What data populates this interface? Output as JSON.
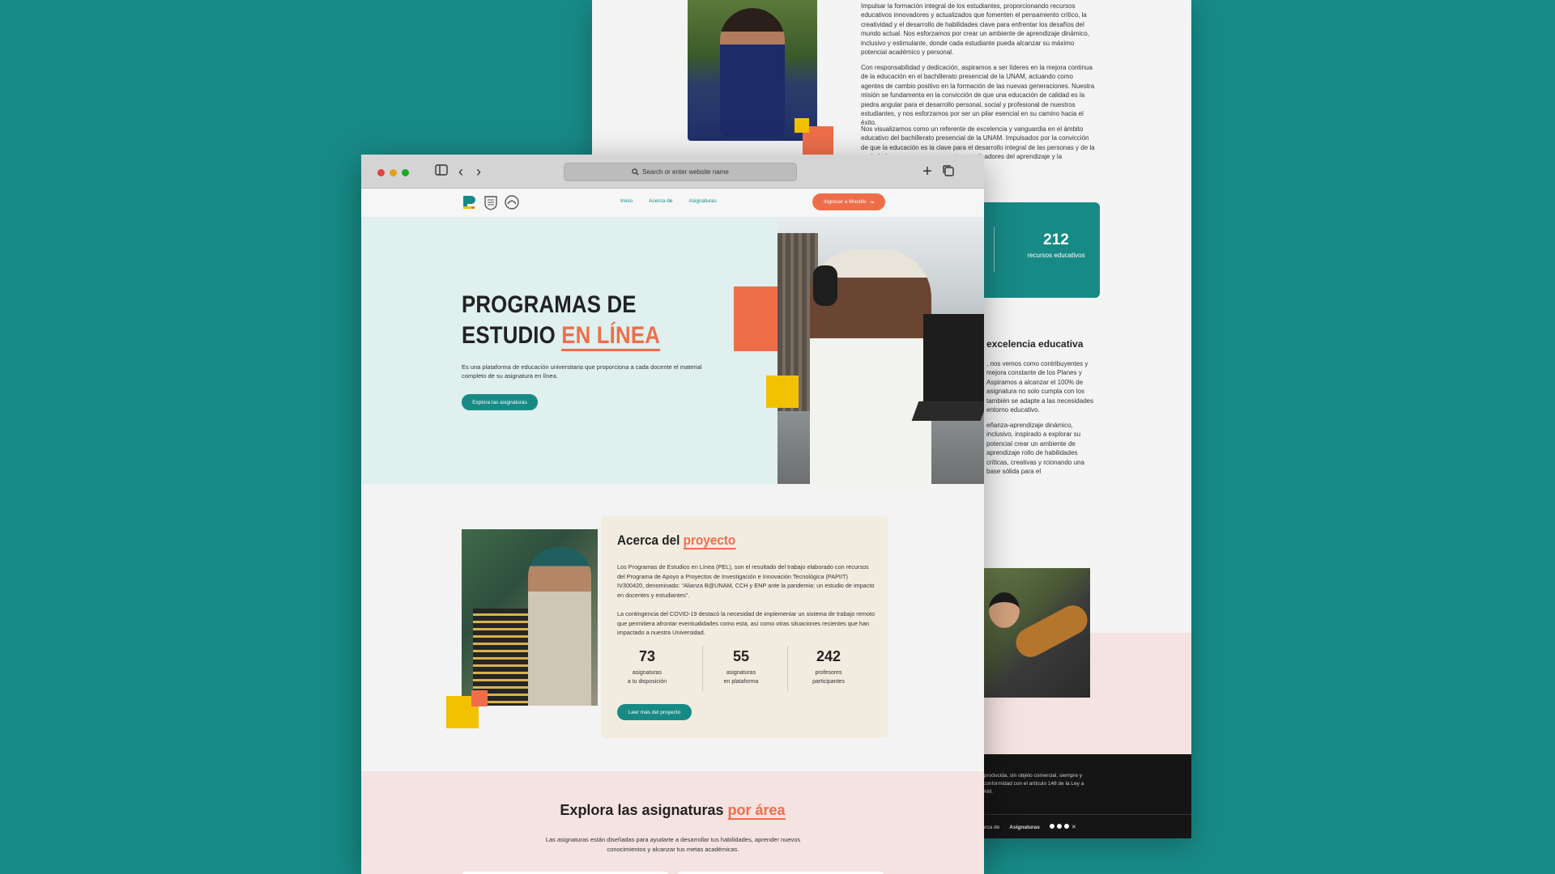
{
  "back_page": {
    "paragraphs": [
      "Impulsar la formación integral de los estudiantes, proporcionando recursos educativos innovadores y actualizados que fomenten el pensamiento crítico, la creatividad y el desarrollo de habilidades clave para enfrentar los desafíos del mundo actual. Nos esforzamos por crear un ambiente de aprendizaje dinámico, inclusivo y estimulante, donde cada estudiante pueda alcanzar su máximo potencial académico y personal.",
      "Con responsabilidad y dedicación, aspiramos a ser líderes en la mejora continua de la educación en el bachillerato presencial de la UNAM, actuando como agentes de cambio positivo en la formación de las nuevas generaciones. Nuestra misión se fundamenta en la convicción de que una educación de calidad es la piedra angular para el desarrollo personal, social y profesional de nuestros estudiantes, y nos esforzamos por ser un pilar esencial en su camino hacia el éxito.",
      "Nos visualizamos como un referente de excelencia y vanguardia en el ámbito educativo del bachillerato presencial de la UNAM. Impulsados por la convicción de que la educación es la clave para el desarrollo integral de las personas y de la sociedad, nos vemos como agentes catalizadores del aprendizaje y la"
    ],
    "stat": {
      "value": "212",
      "label": "recursos educativos",
      "faint": "s"
    },
    "heading": "excelencia educativa",
    "paragraphs2": [
      ", nos vemos como contribuyentes y mejora constante de los Planes y Aspiramos a alcanzar el 100% de asignatura no solo cumpla con los también se adapte a las necesidades entorno educativo.",
      "eñanza-aprendizaje dinámico, inclusivo, inspirado a explorar su potencial crear un ambiente de aprendizaje rollo de habilidades críticas, creativas y rcionando una base sólida para el"
    ],
    "footer": {
      "text": "r reproducida, sin objeto comercial, siempre y de conformidad con el artículo 148 de la Ley a UNAM.",
      "links": [
        "Acerca de",
        "Asignaturas"
      ]
    }
  },
  "browser": {
    "address_placeholder": "Search or enter website name",
    "controls": {
      "sidebar": "sidebar-toggle-icon",
      "back": "‹",
      "forward": "›",
      "new_tab": "+",
      "tabs": "tabs-icon"
    }
  },
  "nav": {
    "links": [
      "Inicio",
      "Acerca de",
      "Asignaturas"
    ],
    "cta": "Ingresar a Moodle"
  },
  "hero": {
    "title_line1": "PROGRAMAS DE",
    "title_line2_plain": "ESTUDIO ",
    "title_line2_accent": "EN LÍNEA",
    "description": "Es una plataforma de educación universitaria que proporciona a cada docente el material completo de su asignatura en línea.",
    "button": "Explora las asignaturas"
  },
  "about": {
    "title_plain": "Acerca del ",
    "title_accent": "proyecto",
    "p1": "Los Programas de Estudios en Línea (PEL), son el resultado del trabajo elaborado con recursos del Programa de Apoyo a Proyectos de Investigación e Innovación Tecnológica (PAPIIT) IV300420, denominado: “Alianza B@UNAM, CCH y ENP ante la pandemia: un estudio de impacto en docentes y estudiantes”.",
    "p2": "La contingencia del COVID-19 destacó la necesidad de implementar un sistema de trabajo remoto que permitiera afrontar eventualidades como esta, así como otras situaciones recientes que han impactado a nuestra Universidad.",
    "stats": [
      {
        "n": "73",
        "l1": "asignaturas",
        "l2": "a tu disposición"
      },
      {
        "n": "55",
        "l1": "asignaturas",
        "l2": "en plataforma"
      },
      {
        "n": "242",
        "l1": "profesores",
        "l2": "participantes"
      }
    ],
    "button": "Leer más del proyecto"
  },
  "explore": {
    "title_plain": "Explora las asignaturas ",
    "title_accent": "por área",
    "description": "Las asignaturas están diseñadas para ayudarte a desarrollar tus habilidades, aprender nuevos conocimientos y alcanzar tus metas académicas."
  },
  "colors": {
    "teal": "#178a86",
    "orange": "#ef6e4a",
    "yellow": "#f2c200",
    "background": "#188a86"
  }
}
